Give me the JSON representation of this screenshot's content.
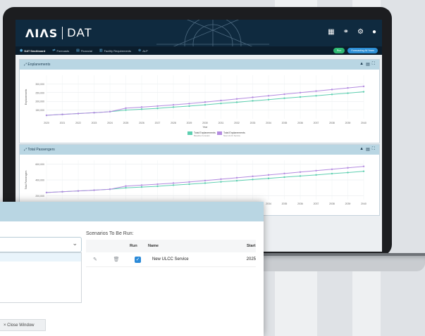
{
  "app": {
    "logo_mark": "ΛΙΛS",
    "logo_product": "DAT"
  },
  "header_icons": [
    "grid-icon",
    "link-icon",
    "gear-icon",
    "user-icon"
  ],
  "nav": {
    "items": [
      {
        "label": "DAT Dashboard",
        "icon": "dashboard-icon",
        "active": true
      },
      {
        "label": "Forecasts",
        "icon": "forecast-icon",
        "active": false
      },
      {
        "label": "Financial",
        "icon": "financial-icon",
        "active": false
      },
      {
        "label": "Facility Requirements",
        "icon": "facility-icon",
        "active": false
      },
      {
        "label": "ALP",
        "icon": "alp-icon",
        "active": false
      }
    ],
    "run_label": "Run",
    "forecasting_label": "Forecasting All Years"
  },
  "panels": [
    {
      "title": "Enplanements",
      "tools": [
        "chart-icon",
        "table-icon",
        "expand-icon"
      ],
      "chart_data": {
        "type": "line",
        "ylabel": "Enplanements",
        "xlabel": "Year",
        "categories": [
          "2020",
          "2021",
          "2022",
          "2023",
          "2024",
          "2025",
          "2026",
          "2027",
          "2028",
          "2029",
          "2030",
          "2031",
          "2032",
          "2033",
          "2034",
          "2035",
          "2036",
          "2037",
          "2038",
          "2039",
          "2040"
        ],
        "yticks": [
          "150,000",
          "200,000",
          "250,000",
          "300,000"
        ],
        "ylim": [
          100000,
          350000
        ],
        "series": [
          {
            "name": "Total Enplanements",
            "color": "#5dcfb0",
            "values": [
              120000,
              125000,
              130000,
              135000,
              141000,
              150000,
              155000,
              160000,
              167000,
              173000,
              180000,
              188000,
              195000,
              203000,
              210000,
              218000,
              225000,
              232000,
              240000,
              247000,
              255000
            ]
          },
          {
            "name": "Total Enplanements",
            "color": "#b48be0",
            "values": [
              120000,
              125000,
              130000,
              135000,
              141000,
              161000,
              167000,
              173000,
              180000,
              187000,
              196000,
              205000,
              214000,
              223000,
              232000,
              241000,
              250000,
              259000,
              268000,
              277000,
              286000
            ]
          }
        ],
        "legend_sub": [
          "Baseline Forecast",
          "New ULCC Service"
        ]
      }
    },
    {
      "title": "Total Passengers",
      "tools": [
        "chart-icon",
        "table-icon",
        "expand-icon"
      ],
      "chart_data": {
        "type": "line",
        "ylabel": "Total Passengers",
        "xlabel": "Year",
        "categories": [
          "2020",
          "2021",
          "2022",
          "2023",
          "2024",
          "2025",
          "2026",
          "2027",
          "2028",
          "2029",
          "2030",
          "2031",
          "2032",
          "2033",
          "2034",
          "2035",
          "2036",
          "2037",
          "2038",
          "2039",
          "2040"
        ],
        "yticks": [
          "200,000",
          "400,000",
          "600,000"
        ],
        "ylim": [
          150000,
          650000
        ],
        "series": [
          {
            "name": "Total Passengers",
            "color": "#5dcfb0",
            "values": [
              240000,
              250000,
              260000,
              270000,
              282000,
              300000,
              310000,
              320000,
              334000,
              346000,
              360000,
              376000,
              390000,
              406000,
              420000,
              436000,
              450000,
              464000,
              480000,
              494000,
              510000
            ]
          },
          {
            "name": "Total Passengers",
            "color": "#b48be0",
            "values": [
              240000,
              250000,
              260000,
              270000,
              282000,
              322000,
              334000,
              346000,
              360000,
              374000,
              392000,
              410000,
              428000,
              446000,
              464000,
              482000,
              500000,
              518000,
              536000,
              554000,
              572000
            ]
          }
        ]
      }
    }
  ],
  "modal": {
    "scenarios_title": "Scenarios To Be Run:",
    "columns": {
      "run": "Run",
      "name": "Name",
      "start": "Start"
    },
    "rows": [
      {
        "name": "New ULCC Service",
        "start": "2025",
        "run": true
      }
    ],
    "close_label": "× Close Window"
  }
}
